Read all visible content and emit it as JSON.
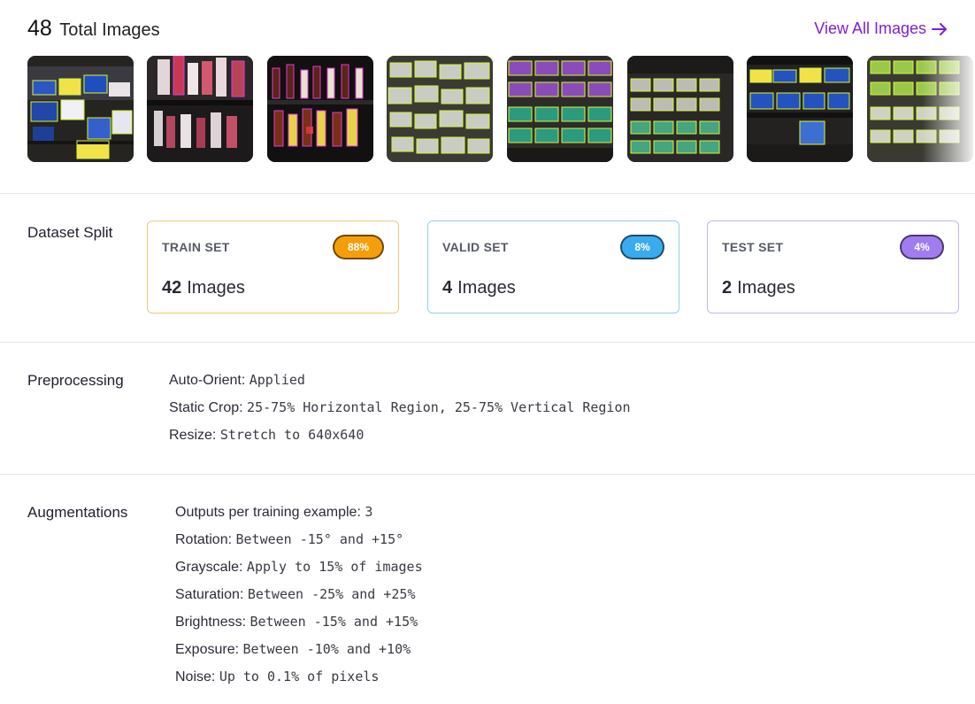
{
  "header": {
    "total_count": "48",
    "total_label": "Total Images",
    "view_all_label": "View All Images"
  },
  "thumbnails": [
    {
      "name": "thumbnail-1",
      "scene": "tissue boxes on dark shelf"
    },
    {
      "name": "thumbnail-2",
      "scene": "bottles on shelf"
    },
    {
      "name": "thumbnail-3",
      "scene": "liquor bottles"
    },
    {
      "name": "thumbnail-4",
      "scene": "product boxes on shelf"
    },
    {
      "name": "thumbnail-5",
      "scene": "purple and green product boxes"
    },
    {
      "name": "thumbnail-6",
      "scene": "boxes on shelves"
    },
    {
      "name": "thumbnail-7",
      "scene": "tissue boxes on dark shelf"
    },
    {
      "name": "thumbnail-8",
      "scene": "green product boxes"
    }
  ],
  "dataset_split": {
    "title": "Dataset Split",
    "sets": [
      {
        "label": "TRAIN SET",
        "badge": "88%",
        "count": "42",
        "unit": "Images",
        "color": "#f59e0b",
        "border": "#f2c77a"
      },
      {
        "label": "VALID SET",
        "badge": "8%",
        "count": "4",
        "unit": "Images",
        "color": "#3aabee",
        "border": "#8fd0f1"
      },
      {
        "label": "TEST SET",
        "badge": "4%",
        "count": "2",
        "unit": "Images",
        "color": "#a07cf0",
        "border": "#c5b3ee"
      }
    ]
  },
  "preprocessing": {
    "title": "Preprocessing",
    "items": [
      {
        "key": "Auto-Orient:",
        "value": "Applied"
      },
      {
        "key": "Static Crop:",
        "value": "25-75% Horizontal Region, 25-75% Vertical Region"
      },
      {
        "key": "Resize:",
        "value": "Stretch to 640x640"
      }
    ]
  },
  "augmentations": {
    "title": "Augmentations",
    "items": [
      {
        "key": "Outputs per training example:",
        "value": "3"
      },
      {
        "key": "Rotation:",
        "value": "Between -15° and +15°"
      },
      {
        "key": "Grayscale:",
        "value": "Apply to 15% of images"
      },
      {
        "key": "Saturation:",
        "value": "Between -25% and +25%"
      },
      {
        "key": "Brightness:",
        "value": "Between -15% and +15%"
      },
      {
        "key": "Exposure:",
        "value": "Between -10% and +10%"
      },
      {
        "key": "Noise:",
        "value": "Up to 0.1% of pixels"
      }
    ]
  },
  "colors": {
    "accent": "#7e1fd0",
    "bbox_yellow": "#d4f53c",
    "bbox_magenta": "#e03cd6"
  }
}
